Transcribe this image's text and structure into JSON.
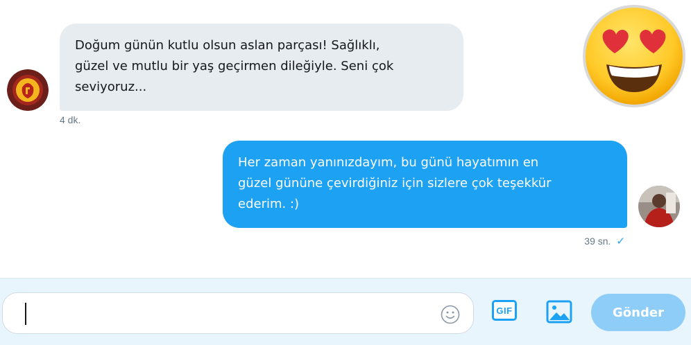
{
  "conversation": {
    "incoming": {
      "lines": [
        "Doğum günün kutlu olsun aslan parçası! Sağlıklı,",
        "güzel ve mutlu bir yaş geçirmen dileğiyle. Seni çok",
        "seviyoruz..."
      ],
      "time": "4 dk.",
      "avatar_icon": "galatasaray-logo-icon"
    },
    "outgoing": {
      "lines": [
        "Her zaman yanınızdayım, bu günü hayatımın en",
        "güzel gününe çevirdiğiniz için sizlere çok teşekkür",
        "ederim. :)"
      ],
      "time": "39 sn.",
      "status_icon": "checkmark-icon",
      "status_glyph": "✓"
    },
    "overlay_emoji": "heart-eyes-emoji-icon"
  },
  "composer": {
    "input_value": "",
    "placeholder": "",
    "emoji_icon": "smiley-icon",
    "gif_label": "GIF",
    "image_icon": "image-icon",
    "send_label": "Gönder"
  },
  "colors": {
    "incoming_bubble": "#e6ecf0",
    "outgoing_bubble": "#1da1f2",
    "accent": "#1da1f2",
    "send_disabled": "#8ecdf8",
    "composer_background": "#e8f5fd"
  }
}
